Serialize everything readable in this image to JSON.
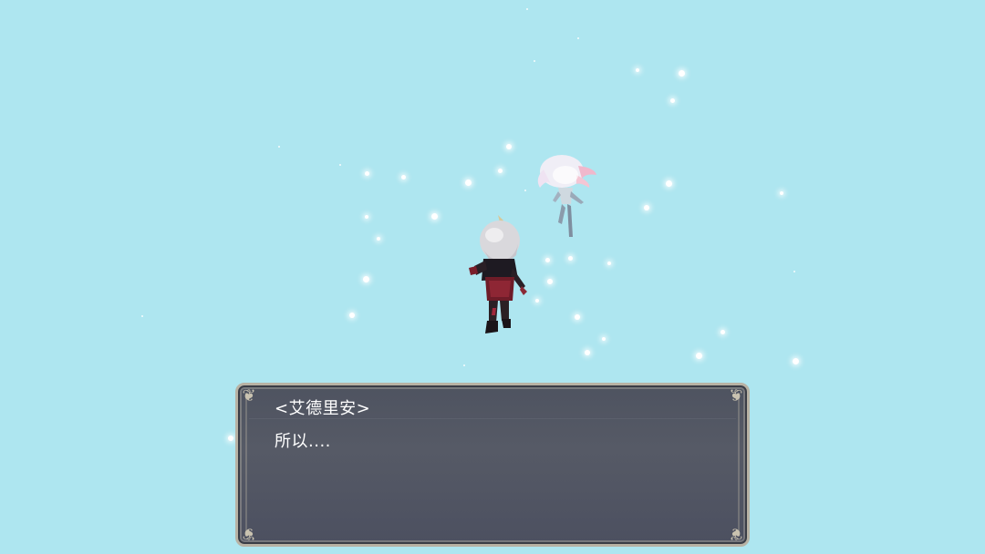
{
  "dialog": {
    "speaker": "<艾德里安>",
    "text": "所以...."
  },
  "scene": {
    "background_color": "#aee6f0",
    "characters": [
      "silver-haired-hero",
      "ghost-spirit"
    ]
  }
}
